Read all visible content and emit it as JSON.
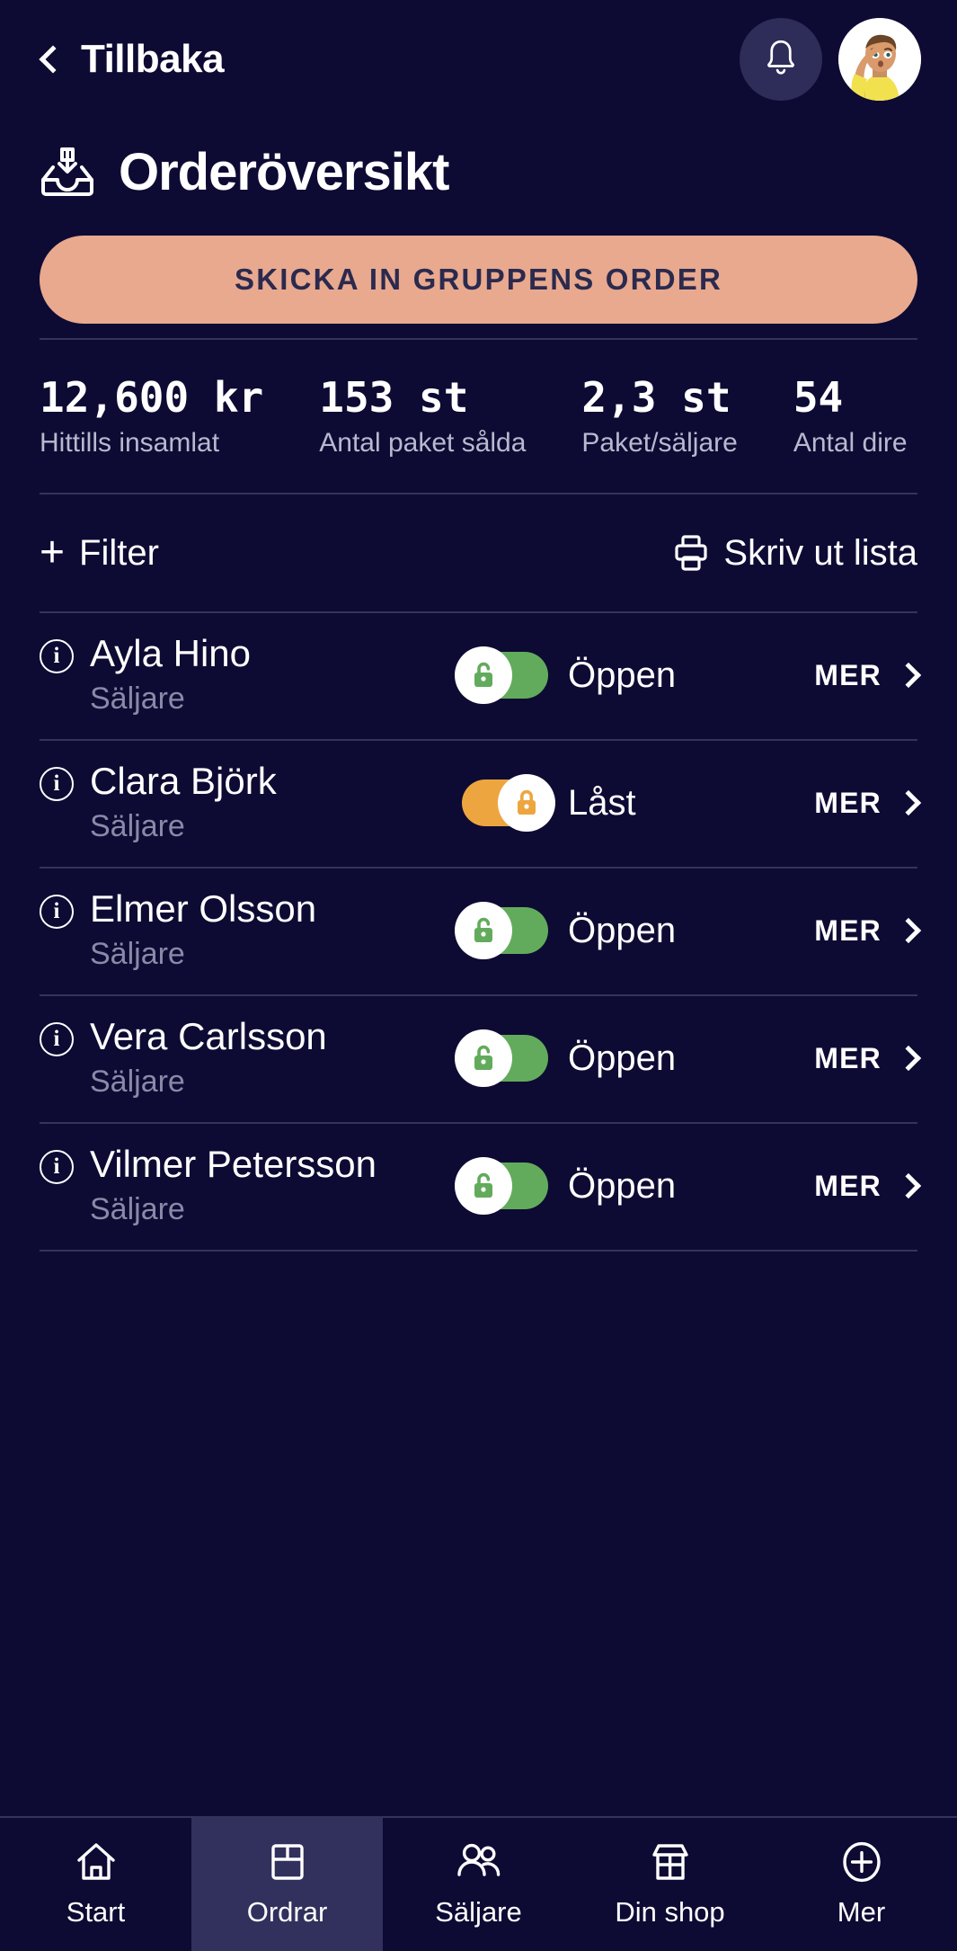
{
  "header": {
    "back_label": "Tillbaka",
    "back_icon": "chevron-left-icon",
    "bell_icon": "bell-icon",
    "avatar_icon": "user-avatar"
  },
  "page": {
    "title": "Orderöversikt",
    "title_icon": "inbox-download-icon"
  },
  "cta": {
    "label": "SKICKA IN GRUPPENS ORDER",
    "bg_color": "#e8a98f",
    "text_color": "#2b2a4e"
  },
  "stats": [
    {
      "value": "12,600 kr",
      "label": "Hittills insamlat"
    },
    {
      "value": "153 st",
      "label": "Antal paket sålda"
    },
    {
      "value": "2,3 st",
      "label": "Paket/säljare"
    },
    {
      "value": "54",
      "label": "Antal dire"
    }
  ],
  "toolbar": {
    "filter_label": "Filter",
    "filter_icon": "plus-icon",
    "print_label": "Skriv ut lista",
    "print_icon": "printer-icon"
  },
  "list": {
    "role_label": "Säljare",
    "more_label": "MER",
    "state_open": "Öppen",
    "state_locked": "Låst",
    "open_color": "#63ab5c",
    "locked_color": "#eda63f",
    "rows": [
      {
        "name": "Ayla Hino",
        "role": "Säljare",
        "state": "Öppen",
        "locked": false
      },
      {
        "name": "Clara Björk",
        "role": "Säljare",
        "state": "Låst",
        "locked": true
      },
      {
        "name": "Elmer Olsson",
        "role": "Säljare",
        "state": "Öppen",
        "locked": false
      },
      {
        "name": "Vera Carlsson",
        "role": "Säljare",
        "state": "Öppen",
        "locked": false
      },
      {
        "name": "Vilmer Petersson",
        "role": "Säljare",
        "state": "Öppen",
        "locked": false
      }
    ]
  },
  "bottom_nav": {
    "items": [
      {
        "label": "Start",
        "icon": "home-icon",
        "active": false
      },
      {
        "label": "Ordrar",
        "icon": "box-icon",
        "active": true
      },
      {
        "label": "Säljare",
        "icon": "people-icon",
        "active": false
      },
      {
        "label": "Din shop",
        "icon": "store-icon",
        "active": false
      },
      {
        "label": "Mer",
        "icon": "plus-circle-icon",
        "active": false
      }
    ]
  },
  "colors": {
    "background": "#0d0b33",
    "divider": "#35335e",
    "muted_text": "#8b89a8",
    "nav_active_bg": "#32305c"
  }
}
